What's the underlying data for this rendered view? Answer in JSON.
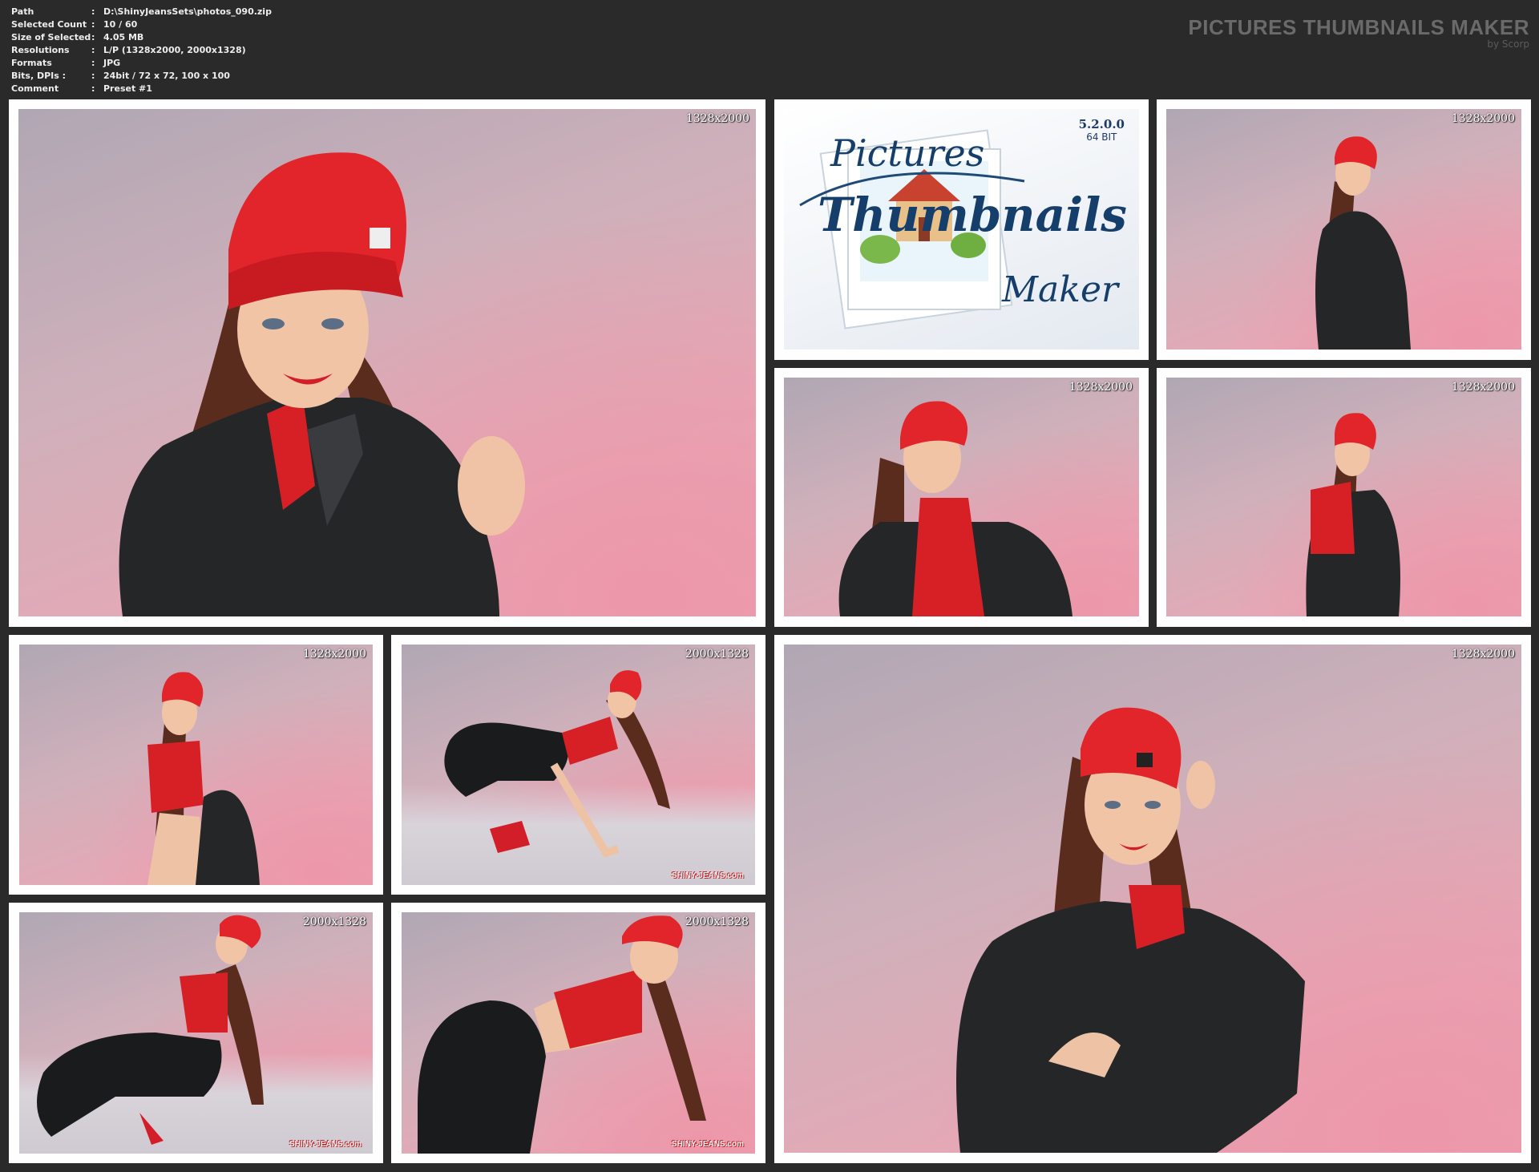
{
  "header": {
    "info": [
      {
        "label": "Path",
        "value": "D:\\ShinyJeansSets\\photos_090.zip"
      },
      {
        "label": "Selected Count",
        "value": "10 / 60"
      },
      {
        "label": "Size of Selected",
        "value": "4.05 MB"
      },
      {
        "label": "Resolutions",
        "value": "L/P (1328x2000, 2000x1328)"
      },
      {
        "label": "Formats",
        "value": "JPG"
      },
      {
        "label": "Bits, DPIs :",
        "value": "24bit / 72 x 72, 100 x 100"
      },
      {
        "label": "Comment",
        "value": "Preset #1"
      }
    ],
    "separator": ":",
    "brand_title": "PICTURES THUMBNAILS MAKER",
    "brand_sub": "by Scorp"
  },
  "logo": {
    "version": "5.2.0.0",
    "bits": "64 BIT",
    "word1": "Pictures",
    "word2": "Thumbnails",
    "word3": "Maker"
  },
  "thumbnails": [
    {
      "resolution": "1328x2000",
      "watermark": ""
    },
    {
      "resolution": "1328x2000",
      "watermark": ""
    },
    {
      "resolution": "1328x2000",
      "watermark": ""
    },
    {
      "resolution": "1328x2000",
      "watermark": ""
    },
    {
      "resolution": "1328x2000",
      "watermark": ""
    },
    {
      "resolution": "2000x1328",
      "watermark": "SHINY-JEANS.com"
    },
    {
      "resolution": "2000x1328",
      "watermark": "SHINY-JEANS.com"
    },
    {
      "resolution": "2000x1328",
      "watermark": "SHINY-JEANS.com"
    },
    {
      "resolution": "1328x2000",
      "watermark": ""
    }
  ],
  "colors": {
    "background": "#2a2a2a",
    "frame": "#fefefe",
    "cap": "#e2252b",
    "jacket": "#252628",
    "hair": "#5a2c1e"
  }
}
